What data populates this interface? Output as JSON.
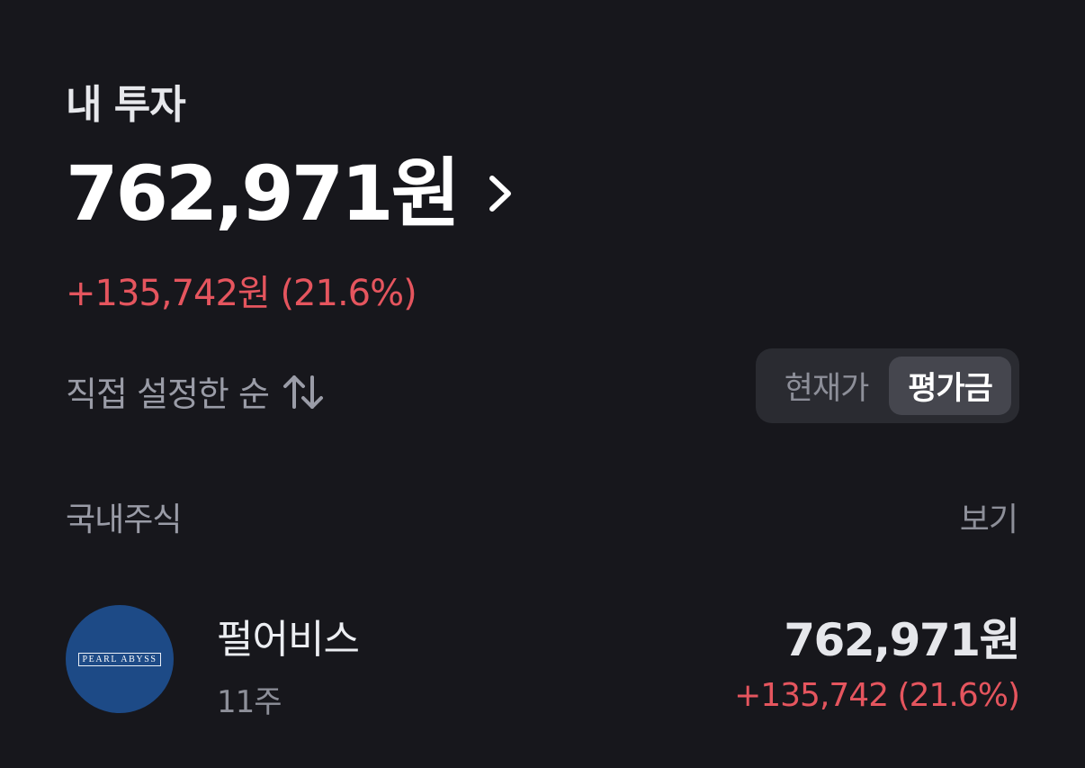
{
  "header": {
    "title": "내 투자",
    "total_amount": "762,971원",
    "total_change": "+135,742원 (21.6%)"
  },
  "sort": {
    "label": "직접 설정한 순",
    "icon": "sort-arrows-icon"
  },
  "toggle": {
    "options": [
      "현재가",
      "평가금"
    ],
    "selected": "평가금"
  },
  "category": {
    "label": "국내주식",
    "view_label": "보기"
  },
  "holdings": [
    {
      "name": "펄어비스",
      "quantity": "11주",
      "value": "762,971원",
      "change": "+135,742 (21.6%)",
      "logo_text": "PEARL ABYSS"
    }
  ],
  "colors": {
    "background": "#17171c",
    "gain": "#e5555e",
    "logo": "#1d4a86"
  }
}
